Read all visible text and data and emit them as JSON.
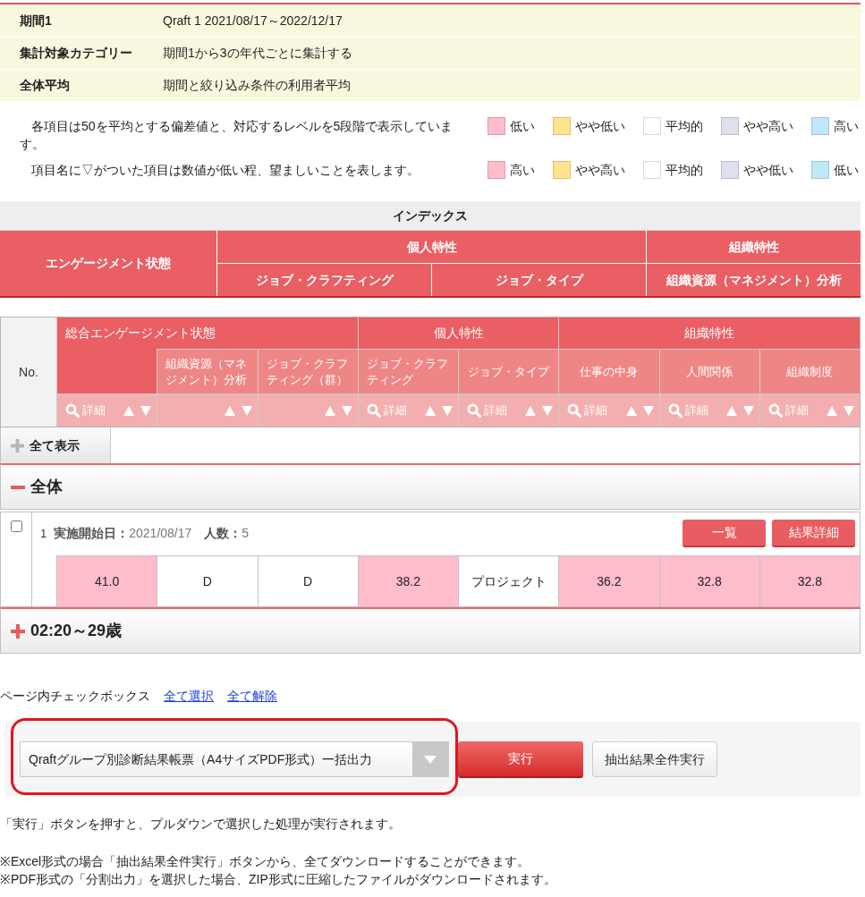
{
  "period_info": [
    {
      "label": "期間1",
      "value": "Qraft 1 2021/08/17～2022/12/17"
    },
    {
      "label": "集計対象カテゴリー",
      "value": "期間1から3の年代ごとに集計する"
    },
    {
      "label": "全体平均",
      "value": "期間と絞り込み条件の利用者平均"
    }
  ],
  "legend": [
    {
      "text": "各項目は50を平均とする偏差値と、対応するレベルを5段階で表示しています。",
      "items": [
        {
          "label": "低い",
          "color": "#ffbccb"
        },
        {
          "label": "やや低い",
          "color": "#ffe48c"
        },
        {
          "label": "平均的",
          "color": "#ffffff"
        },
        {
          "label": "やや高い",
          "color": "#dfe0ef"
        },
        {
          "label": "高い",
          "color": "#bfe9fb"
        }
      ]
    },
    {
      "text": "項目名に▽がついた項目は数値が低い程、望ましいことを表します。",
      "items": [
        {
          "label": "高い",
          "color": "#ffbccb"
        },
        {
          "label": "やや高い",
          "color": "#ffe48c"
        },
        {
          "label": "平均的",
          "color": "#ffffff"
        },
        {
          "label": "やや低い",
          "color": "#dfe0ef"
        },
        {
          "label": "低い",
          "color": "#bfe9fb"
        }
      ]
    }
  ],
  "index_table": {
    "title": "インデックス",
    "first_column": "エンゲージメント状態",
    "groups": [
      {
        "label": "個人特性",
        "columns": [
          "ジョブ・クラフティング",
          "ジョブ・タイプ"
        ]
      },
      {
        "label": "組織特性",
        "columns": [
          "組織資源（マネジメント）分析"
        ]
      }
    ]
  },
  "results_table": {
    "number_header": "No.",
    "groups": [
      {
        "label": "総合エンゲージメント状態",
        "columns": [
          {
            "detail": "詳細"
          },
          {
            "label": "組織資源（マネジメント）分析"
          },
          {
            "label": "ジョブ・クラフティング（群）"
          }
        ]
      },
      {
        "label": "個人特性",
        "columns": [
          {
            "label": "ジョブ・クラフティング",
            "detail": "詳細"
          },
          {
            "label": "ジョブ・タイプ",
            "detail": "詳細"
          }
        ]
      },
      {
        "label": "組織特性",
        "columns": [
          {
            "label": "仕事の中身",
            "detail": "詳細"
          },
          {
            "label": "人間関係",
            "detail": "詳細"
          },
          {
            "label": "組織制度",
            "detail": "詳細"
          }
        ]
      }
    ],
    "show_all": "全て表示"
  },
  "result_groups": [
    {
      "label": "全体",
      "expanded": true,
      "rows": [
        {
          "number": "1",
          "checked": false,
          "summary": "**実施開始日：**2021/08/17　**人数：**5",
          "buttons": [
            "一覧",
            "結果詳細"
          ],
          "cells": [
            {
              "value": "41.0",
              "color": "#ffbccb"
            },
            {
              "value": "D",
              "color": "#ffffff"
            },
            {
              "value": "D",
              "color": "#ffffff"
            },
            {
              "value": "38.2",
              "color": "#ffbccb"
            },
            {
              "value": "プロジェクト",
              "color": "#ffffff"
            },
            {
              "value": "36.2",
              "color": "#ffbccb"
            },
            {
              "value": "32.8",
              "color": "#ffbccb"
            },
            {
              "value": "32.8",
              "color": "#ffbccb"
            }
          ]
        }
      ]
    },
    {
      "label": "02:20～29歳",
      "expanded": false
    }
  ],
  "page_checkboxes": {
    "label": "ページ内チェックボックス",
    "links": [
      "全て選択",
      "全て解除"
    ]
  },
  "action_panel": {
    "selected_option": "Qraftグループ別診断結果帳票（A4サイズPDF形式）一括出力",
    "highlighted": true,
    "buttons": [
      {
        "label": "実行",
        "kind": "primary"
      },
      {
        "label": "抽出結果全件実行",
        "kind": "secondary"
      }
    ]
  },
  "notes": [
    [
      "「実行」ボタンを押すと、プルダウンで選択した処理が実行されます。"
    ],
    [
      "※Excel形式の場合「抽出結果全件実行」ボタンから、全てダウンロードすることができます。",
      "※PDF形式の「分割出力」を選択した場合、ZIP形式に圧縮したファイルがダウンロードされます。"
    ]
  ]
}
